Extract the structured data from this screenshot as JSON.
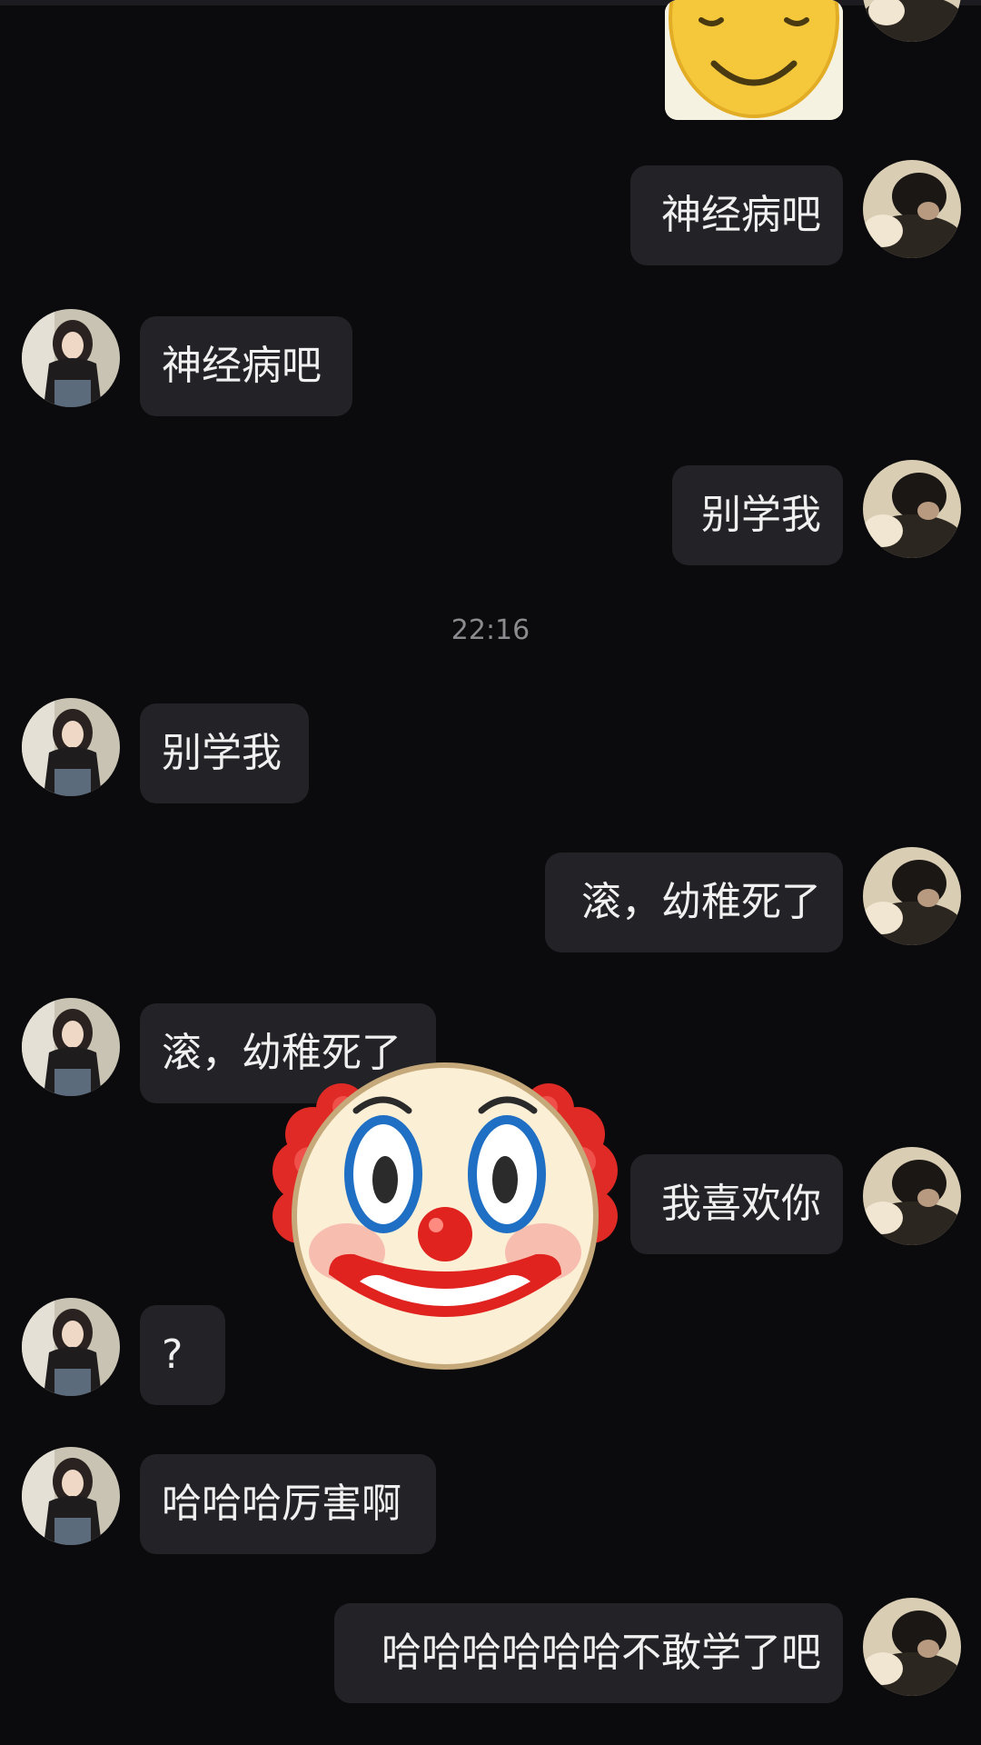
{
  "conversation": {
    "timestamp": "22:16",
    "messages": [
      {
        "side": "right",
        "type": "sticker",
        "sticker": "smiley-face"
      },
      {
        "side": "right",
        "text": "神经病吧"
      },
      {
        "side": "left",
        "text": "神经病吧"
      },
      {
        "side": "right",
        "text": "别学我"
      },
      {
        "side": "left",
        "text": "别学我"
      },
      {
        "side": "right",
        "text": "滚，幼稚死了"
      },
      {
        "side": "left",
        "text": "滚，幼稚死了"
      },
      {
        "side": "right",
        "text": "我喜欢你"
      },
      {
        "side": "left",
        "text": "?"
      },
      {
        "side": "left",
        "text": "哈哈哈厉害啊"
      },
      {
        "side": "right",
        "text": "哈哈哈哈哈哈不敢学了吧"
      }
    ]
  },
  "overlay": {
    "emoji": "clown-face"
  },
  "colors": {
    "background": "#0b0b0d",
    "bubble": "#222227",
    "text": "#f0f0f0",
    "timestamp": "#8a8a8f"
  }
}
